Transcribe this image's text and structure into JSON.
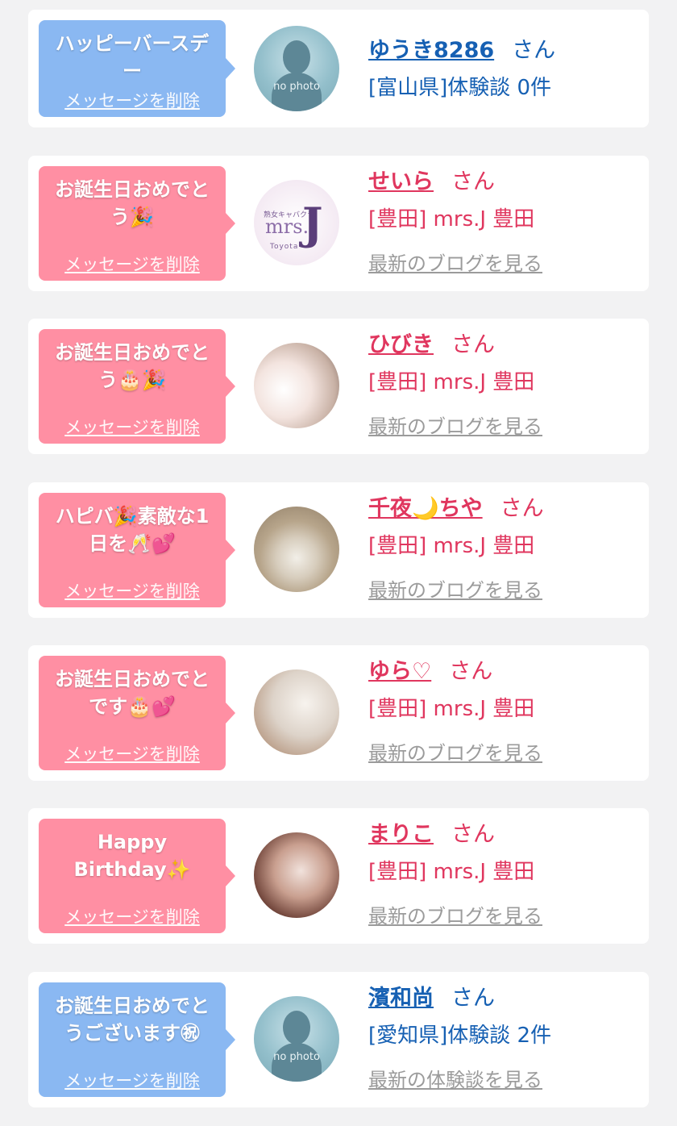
{
  "cards": [
    {
      "bubble_color": "blue",
      "message": "ハッピーバースデー",
      "delete_label": "メッセージを削除",
      "avatar": "no photo",
      "name": "ゆうき8286",
      "suffix": "さん",
      "name_color": "#1660b3",
      "info": "[富山県]体験談 0件",
      "link": ""
    },
    {
      "bubble_color": "pink",
      "message": "お誕生日おめでとう🎉",
      "delete_label": "メッセージを削除",
      "avatar_logo": {
        "small": "熟女キャバクラ",
        "mrs": "mrs.",
        "j": "J",
        "sub": "Toyota"
      },
      "name": "せいら",
      "suffix": "さん",
      "name_color": "#e0365e",
      "info": "[豊田] mrs.J 豊田",
      "link": "最新のブログを見る"
    },
    {
      "bubble_color": "pink",
      "message": "お誕生日おめでとう🎂🎉",
      "delete_label": "メッセージを削除",
      "name": "ひびき",
      "suffix": "さん",
      "name_color": "#e0365e",
      "info": "[豊田] mrs.J 豊田",
      "link": "最新のブログを見る"
    },
    {
      "bubble_color": "pink",
      "message": "ハピバ🎉素敵な1日を🥂💕",
      "delete_label": "メッセージを削除",
      "name": "千夜🌙ちや",
      "suffix": "さん",
      "name_color": "#e0365e",
      "info": "[豊田] mrs.J 豊田",
      "link": "最新のブログを見る"
    },
    {
      "bubble_color": "pink",
      "message": "お誕生日おめでとです🎂💕",
      "delete_label": "メッセージを削除",
      "name": "ゆら♡",
      "suffix": "さん",
      "name_color": "#e0365e",
      "info": "[豊田] mrs.J 豊田",
      "link": "最新のブログを見る"
    },
    {
      "bubble_color": "pink",
      "message": "Happy Birthday✨",
      "delete_label": "メッセージを削除",
      "name": "まりこ",
      "suffix": "さん",
      "name_color": "#e0365e",
      "info": "[豊田] mrs.J 豊田",
      "link": "最新のブログを見る"
    },
    {
      "bubble_color": "blue",
      "message": "お誕生日おめでとうございます㊗",
      "delete_label": "メッセージを削除",
      "avatar": "no photo",
      "name": "濱和尚",
      "suffix": "さん",
      "name_color": "#1660b3",
      "info": "[愛知県]体験談 2件",
      "link": "最新の体験談を見る"
    }
  ]
}
